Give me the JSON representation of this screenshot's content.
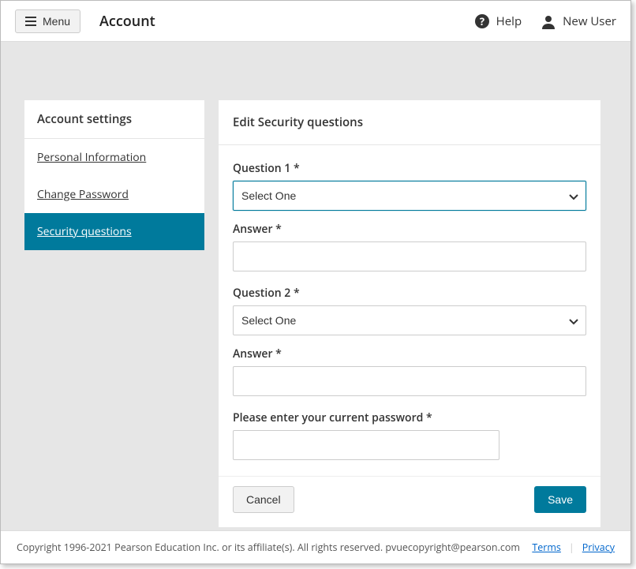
{
  "header": {
    "menu_label": "Menu",
    "page_title": "Account",
    "help_label": "Help",
    "user_label": "New User"
  },
  "sidebar": {
    "title": "Account settings",
    "items": [
      {
        "label": "Personal Information",
        "active": false
      },
      {
        "label": "Change Password",
        "active": false
      },
      {
        "label": "Security questions",
        "active": true
      }
    ]
  },
  "panel": {
    "title": "Edit Security questions",
    "q1_label": "Question 1 *",
    "q1_value": "Select One",
    "a1_label": "Answer *",
    "a1_value": "",
    "q2_label": "Question 2 *",
    "q2_value": "Select One",
    "a2_label": "Answer *",
    "a2_value": "",
    "password_label": "Please enter your current password *",
    "password_value": "",
    "cancel_label": "Cancel",
    "save_label": "Save"
  },
  "footer": {
    "copyright": "Copyright 1996-2021 Pearson Education Inc. or its affiliate(s). All rights reserved. pvuecopyright@pearson.com",
    "terms_label": "Terms ",
    "privacy_label": "Privacy"
  }
}
